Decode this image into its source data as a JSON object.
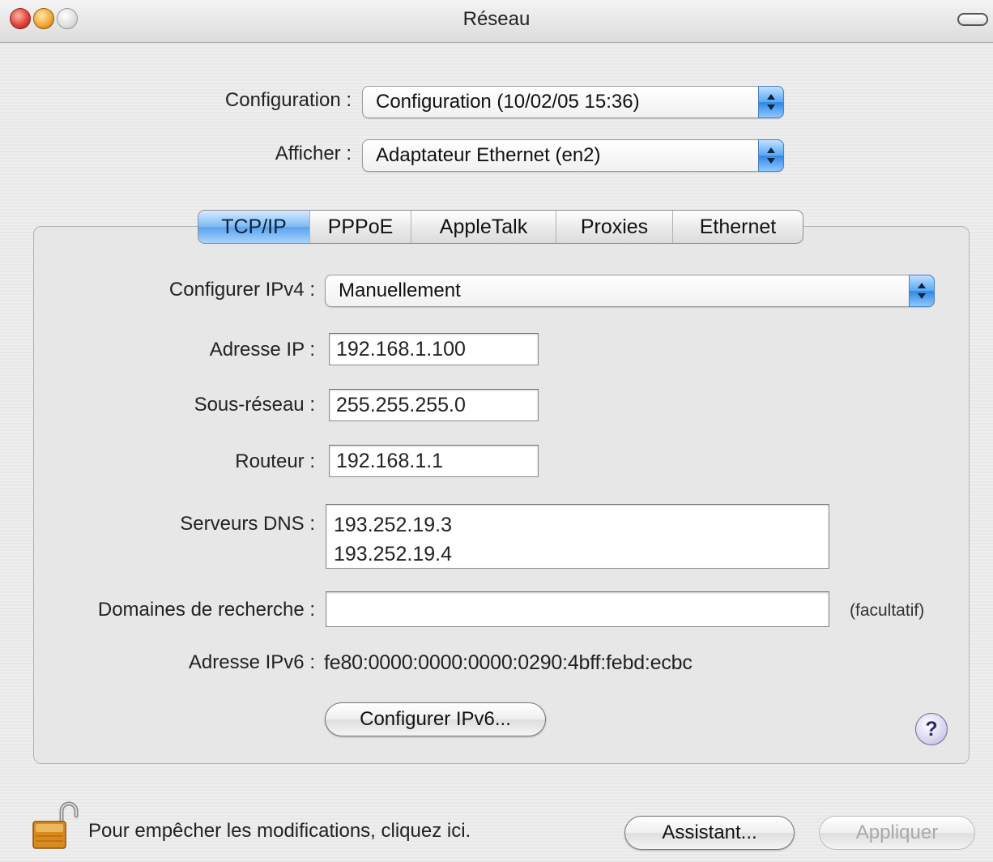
{
  "window": {
    "title": "Réseau"
  },
  "top": {
    "configuration": {
      "label": "Configuration :",
      "value": "Configuration (10/02/05 15:36)"
    },
    "afficher": {
      "label": "Afficher :",
      "value": "Adaptateur Ethernet (en2)"
    }
  },
  "tabs": [
    {
      "label": "TCP/IP",
      "active": true
    },
    {
      "label": "PPPoE",
      "active": false
    },
    {
      "label": "AppleTalk",
      "active": false
    },
    {
      "label": "Proxies",
      "active": false
    },
    {
      "label": "Ethernet",
      "active": false
    }
  ],
  "tcpip": {
    "configurer_ipv4": {
      "label": "Configurer IPv4 :",
      "value": "Manuellement"
    },
    "adresse_ip": {
      "label": "Adresse IP :",
      "value": "192.168.1.100"
    },
    "sous_reseau": {
      "label": "Sous-réseau :",
      "value": "255.255.255.0"
    },
    "routeur": {
      "label": "Routeur :",
      "value": "192.168.1.1"
    },
    "serveurs_dns": {
      "label": "Serveurs DNS :",
      "values": [
        "193.252.19.3",
        "193.252.19.4"
      ]
    },
    "domaines": {
      "label": "Domaines de recherche :",
      "value": "",
      "hint": "(facultatif)"
    },
    "ipv6": {
      "label": "Adresse IPv6 :",
      "value": "fe80:0000:0000:0000:0290:4bff:febd:ecbc"
    },
    "configurer_ipv6_button": "Configurer IPv6...",
    "help_button": "?"
  },
  "footer": {
    "lock_text": "Pour empêcher les modifications, cliquez ici.",
    "assistant_button": "Assistant...",
    "apply_button": "Appliquer"
  },
  "icons": {
    "close": "close-icon",
    "minimize": "minimize-icon",
    "zoom": "zoom-icon",
    "toolbar": "toolbar-toggle-icon",
    "lock": "padlock-open-icon",
    "help": "help-icon"
  },
  "colors": {
    "accent": "#5aa3ec",
    "close_light": "#e0443a",
    "minimize_light": "#f2a93b",
    "help_tint": "#b5aee0"
  }
}
